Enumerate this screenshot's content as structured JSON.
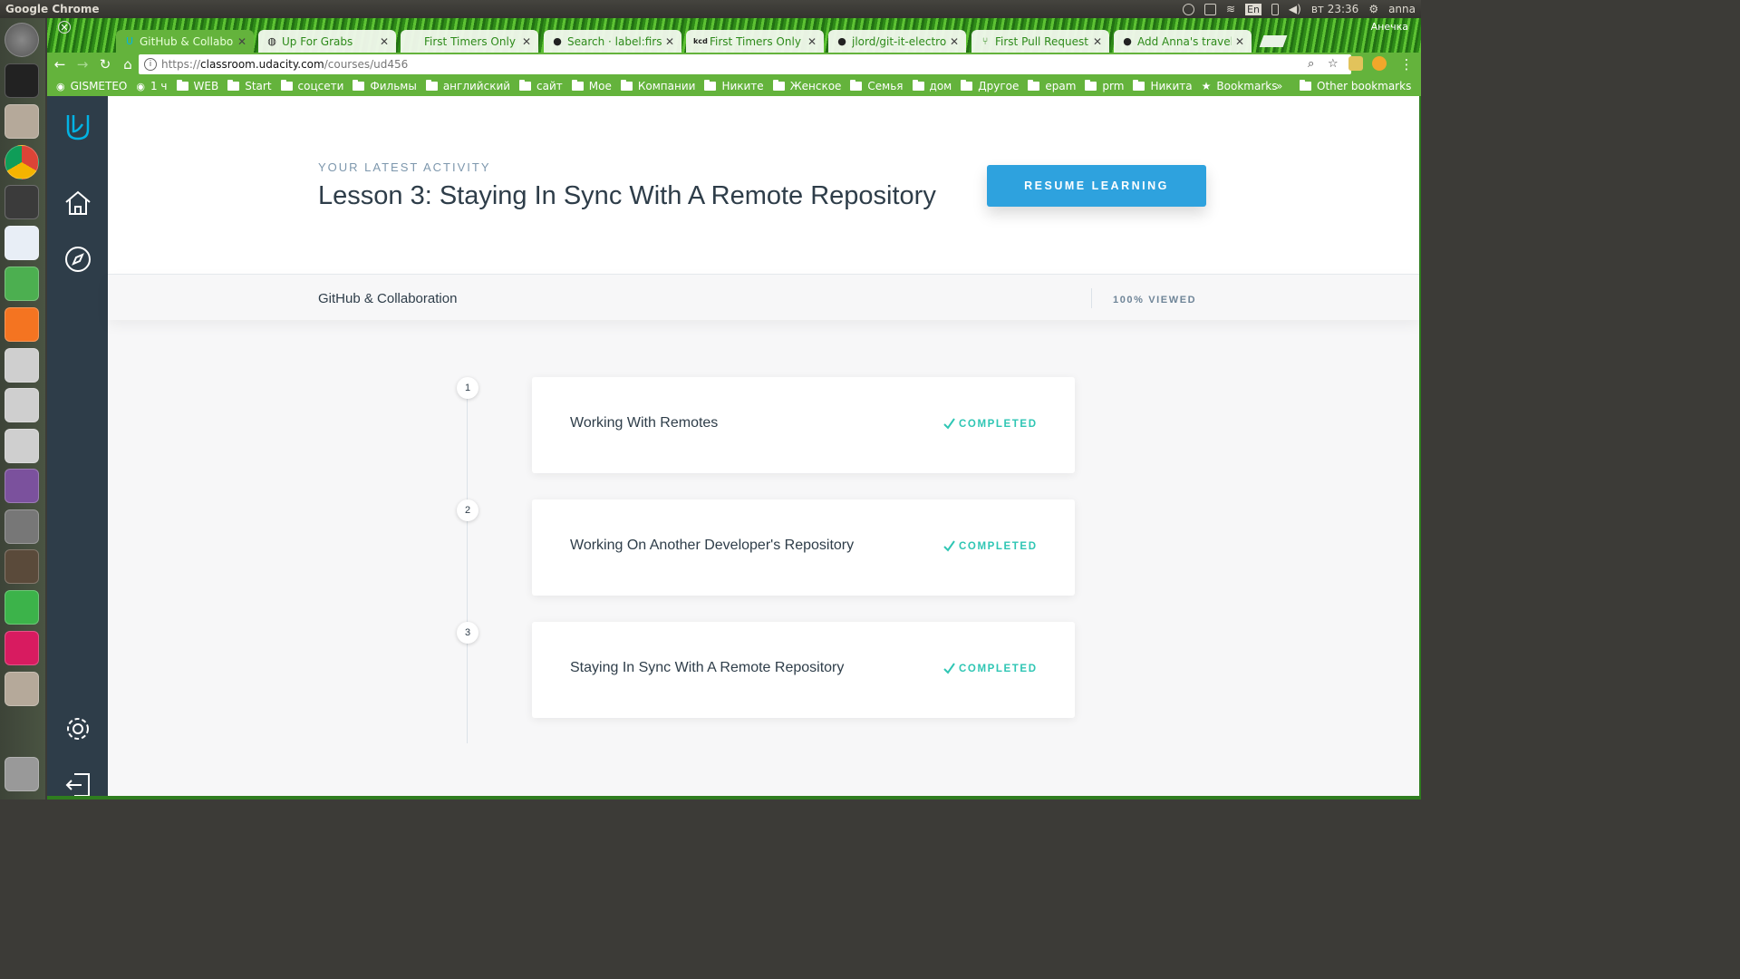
{
  "system": {
    "app_name": "Google Chrome",
    "keyboard_layout": "En",
    "clock": "вт 23:36",
    "user": "anna"
  },
  "browser": {
    "profile_name": "Анечка",
    "tabs": [
      {
        "title": "GitHub & Collabora",
        "icon": "udacity-icon",
        "active": true
      },
      {
        "title": "Up For Grabs",
        "icon": "globe-icon",
        "active": false
      },
      {
        "title": "First Timers Only - (",
        "icon": "blank-icon",
        "active": false
      },
      {
        "title": "Search · label:first-t",
        "icon": "github-icon",
        "active": false
      },
      {
        "title": "First Timers Only –",
        "icon": "kcd-icon",
        "active": false
      },
      {
        "title": "jlord/git-it-electron",
        "icon": "github-icon",
        "active": false
      },
      {
        "title": "First Pull Request -",
        "icon": "pull-request-icon",
        "active": false
      },
      {
        "title": "Add Anna's travel p",
        "icon": "github-icon",
        "active": false
      }
    ],
    "url": {
      "scheme": "https://",
      "host": "classroom.udacity.com",
      "path": "/courses/ud456"
    },
    "bookmarks": [
      {
        "label": "GISMETEO",
        "type": "site"
      },
      {
        "label": "1 ч",
        "type": "site"
      },
      {
        "label": "WEB",
        "type": "folder"
      },
      {
        "label": "Start",
        "type": "folder"
      },
      {
        "label": "соцсети",
        "type": "folder"
      },
      {
        "label": "Фильмы",
        "type": "folder"
      },
      {
        "label": "английский",
        "type": "folder"
      },
      {
        "label": "сайт",
        "type": "folder"
      },
      {
        "label": "Мое",
        "type": "folder"
      },
      {
        "label": "Компании",
        "type": "folder"
      },
      {
        "label": "Никите",
        "type": "folder"
      },
      {
        "label": "Женское",
        "type": "folder"
      },
      {
        "label": "Семья",
        "type": "folder"
      },
      {
        "label": "дом",
        "type": "folder"
      },
      {
        "label": "Другое",
        "type": "folder"
      },
      {
        "label": "epam",
        "type": "folder"
      },
      {
        "label": "prm",
        "type": "folder"
      },
      {
        "label": "Никита",
        "type": "folder"
      },
      {
        "label": "Bookmarks",
        "type": "star"
      }
    ],
    "bookmarks_overflow": "»",
    "other_bookmarks": "Other bookmarks"
  },
  "page": {
    "latest_label": "YOUR LATEST ACTIVITY",
    "lesson_title": "Lesson 3: Staying In Sync With A Remote Repository",
    "resume_button": "RESUME LEARNING",
    "course_name": "GitHub & Collaboration",
    "viewed": "100% VIEWED",
    "lessons": [
      {
        "number": "1",
        "title": "Working With Remotes",
        "status": "COMPLETED"
      },
      {
        "number": "2",
        "title": "Working On Another Developer's Repository",
        "status": "COMPLETED"
      },
      {
        "number": "3",
        "title": "Staying In Sync With A Remote Repository",
        "status": "COMPLETED"
      }
    ]
  },
  "colors": {
    "sidebar": "#2e3d49",
    "accent": "#2ea2de",
    "completed": "#2fc6b4",
    "browser_frame": "#64b33c"
  }
}
